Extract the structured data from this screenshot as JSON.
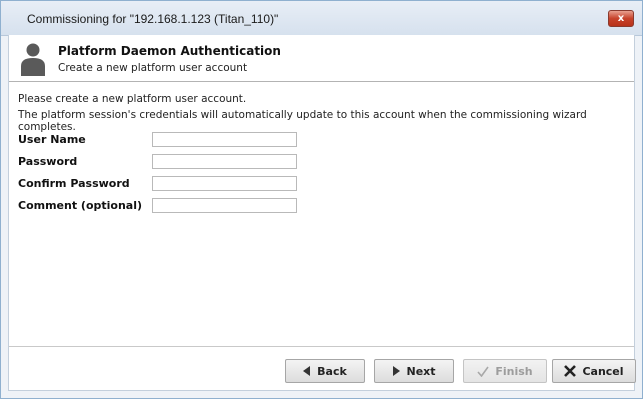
{
  "window": {
    "title": "Commissioning for \"192.168.1.123 (Titan_110)\"",
    "close_label": "x"
  },
  "header": {
    "title": "Platform Daemon Authentication",
    "subtitle": "Create a new platform user account"
  },
  "intro": {
    "line1": "Please create a new platform user account.",
    "line2": "The platform session's credentials will automatically update to this account when the commissioning wizard completes."
  },
  "form": {
    "user_name_label": "User Name",
    "password_label": "Password",
    "confirm_password_label": "Confirm Password",
    "comment_label": "Comment (optional)",
    "user_name_value": "",
    "password_value": "",
    "confirm_password_value": "",
    "comment_value": ""
  },
  "buttons": {
    "back_label": "Back",
    "next_label": "Next",
    "finish_label": "Finish",
    "cancel_label": "Cancel"
  },
  "icons": {
    "header_icon": "user-avatar-icon",
    "back_icon": "arrow-left-icon",
    "next_icon": "arrow-right-icon",
    "finish_icon": "checkmark-icon",
    "cancel_icon": "x-mark-icon"
  },
  "colors": {
    "close_button": "#c7432b",
    "disabled_text": "#9c9c9c"
  }
}
